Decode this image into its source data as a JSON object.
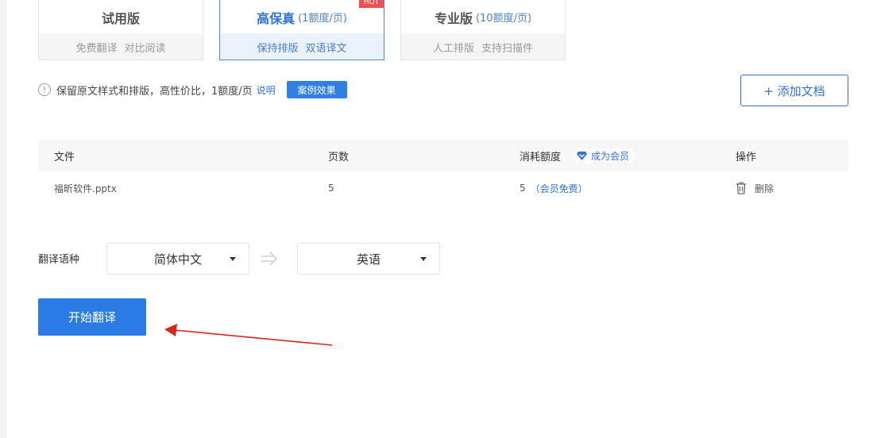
{
  "plans": [
    {
      "name": "试用版",
      "price": "",
      "features": [
        "免费翻译",
        "对比阅读"
      ]
    },
    {
      "name": "高保真",
      "price": "(1额度/页)",
      "features": [
        "保持排版",
        "双语译文"
      ],
      "badge": "HOT",
      "active": true
    },
    {
      "name": "专业版",
      "price": "(10额度/页)",
      "features": [
        "人工排版",
        "支持扫描件"
      ]
    }
  ],
  "info": {
    "icon": "info-circle-icon",
    "text": "保留原文样式和排版，高性价比，1额度/页",
    "link": "说明",
    "case_button": "案例效果"
  },
  "add_doc_button": "+ 添加文档",
  "table": {
    "headers": [
      "文件",
      "页数",
      "消耗额度",
      "操作"
    ],
    "vip_badge": "成为会员",
    "rows": [
      {
        "file": "福昕软件.pptx",
        "pages": "5",
        "cost": "5",
        "cost_note": "（会员免费）",
        "action": "删除"
      }
    ]
  },
  "language": {
    "label": "翻译语种",
    "source": "简体中文",
    "target": "英语"
  },
  "start_button": "开始翻译",
  "colors": {
    "accent": "#2b7be6",
    "hot": "#ef4f4f",
    "annotation_arrow": "#d9261c"
  }
}
